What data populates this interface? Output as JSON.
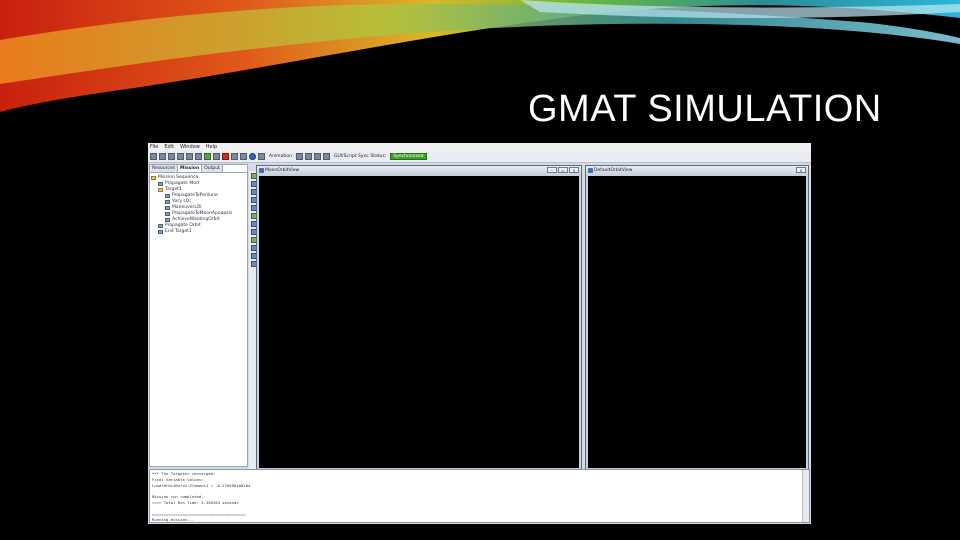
{
  "slide": {
    "title": "GMAT SIMULATION"
  },
  "app": {
    "menu": [
      "File",
      "Edit",
      "Window",
      "Help"
    ],
    "toolbar": {
      "animation_label": "Animation",
      "script_status_label": "GUI/Script Sync Status:",
      "script_status_value": "Synchronized"
    },
    "left_panel": {
      "tabs": [
        "Resources",
        "Mission",
        "Output"
      ],
      "active_tab": "Mission",
      "tree": [
        {
          "label": "Mission Sequence",
          "indent": 0,
          "kind": "folder"
        },
        {
          "label": "Propagate Mod",
          "indent": 1,
          "kind": "item"
        },
        {
          "label": "Target1",
          "indent": 1,
          "kind": "folder"
        },
        {
          "label": "PropagateToPerilune",
          "indent": 2,
          "kind": "item"
        },
        {
          "label": "Vary LOI",
          "indent": 2,
          "kind": "item"
        },
        {
          "label": "ManeuverLOI",
          "indent": 2,
          "kind": "item"
        },
        {
          "label": "PropagateToMoonApoapsis",
          "indent": 2,
          "kind": "item"
        },
        {
          "label": "AchieveWantingOrbit",
          "indent": 2,
          "kind": "item"
        },
        {
          "label": "Propagate Orbit",
          "indent": 1,
          "kind": "item"
        },
        {
          "label": "End Target1",
          "indent": 1,
          "kind": "item"
        }
      ]
    },
    "windows": [
      {
        "title": "MoonOrbitView"
      },
      {
        "title": "DefaultOrbitView"
      }
    ],
    "output_lines": [
      "*** The Targeter converged!",
      "Final Variable values:",
      "LunarOrbitBurn1.Element1 = -0.270490108164",
      "",
      "Mission run completed.",
      "===> Total Run Time: 5.350204 seconds",
      "",
      "========================================",
      "Running mission..."
    ]
  },
  "colors": {
    "status_green": "#3ea12a",
    "background": "#000000",
    "swoosh_red": "#d32a12",
    "swoosh_orange": "#f28d1f",
    "swoosh_green": "#7cc23a",
    "swoosh_cyan": "#29b7d6"
  }
}
